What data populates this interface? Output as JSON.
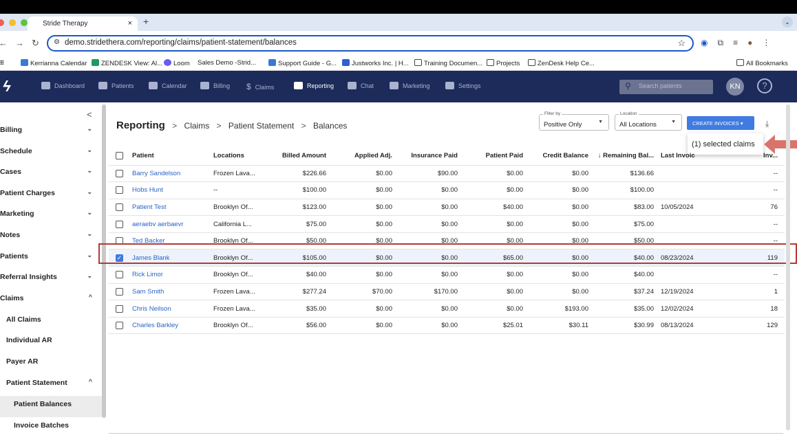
{
  "browser": {
    "tab_title": "Stride Therapy",
    "tab_close": "×",
    "new_tab": "+",
    "url": "demo.stridethera.com/reporting/claims/patient-statement/balances",
    "bookmarks": [
      "Kerrianna Calendar",
      "ZENDESK View: Al...",
      "Loom",
      "Sales Demo -Strid...",
      "Support Guide - G...",
      "Justworks Inc. | H...",
      "Training Documen...",
      "Projects",
      "ZenDesk Help Ce..."
    ],
    "all_bookmarks": "All Bookmarks"
  },
  "appnav": {
    "items": [
      "Dashboard",
      "Patients",
      "Calendar",
      "Billing",
      "Claims",
      "Reporting",
      "Chat",
      "Marketing",
      "Settings"
    ],
    "active": "Reporting",
    "search_placeholder": "Search patients",
    "avatar_initials": "KN",
    "help": "?"
  },
  "sidebar": {
    "collapse": "<",
    "items": [
      {
        "label": "Billing",
        "caret": "⌄"
      },
      {
        "label": "Schedule",
        "caret": "⌄"
      },
      {
        "label": "Cases",
        "caret": "⌄"
      },
      {
        "label": "Patient Charges",
        "caret": "⌄"
      },
      {
        "label": "Marketing",
        "caret": "⌄"
      },
      {
        "label": "Notes",
        "caret": "⌄"
      },
      {
        "label": "Patients",
        "caret": "⌄"
      },
      {
        "label": "Referral Insights",
        "caret": "⌄"
      },
      {
        "label": "Claims",
        "caret": "^"
      },
      {
        "label": "All Claims",
        "caret": ""
      },
      {
        "label": "Individual AR",
        "caret": ""
      },
      {
        "label": "Payer AR",
        "caret": ""
      },
      {
        "label": "Patient Statement",
        "caret": "^"
      },
      {
        "label": "Patient Balances",
        "caret": ""
      },
      {
        "label": "Invoice Batches",
        "caret": ""
      }
    ]
  },
  "breadcrumb": {
    "root": "Reporting",
    "items": [
      "Claims",
      "Patient Statement",
      "Balances"
    ],
    "sep": ">"
  },
  "filters": {
    "filter_label": "Filter by",
    "filter_value": "Positive Only",
    "location_label": "Location",
    "location_value": "All Locations"
  },
  "create_invoices": "CREATE INVOICES",
  "popup_text": "(1) selected claims",
  "table": {
    "columns": [
      "Patient",
      "Locations",
      "Billed Amount",
      "Applied Adj.",
      "Insurance Paid",
      "Patient Paid",
      "Credit Balance",
      "↓ Remaining Bal...",
      "Last Invoic",
      "Inv..."
    ],
    "rows": [
      {
        "name": "Barry Sandelson",
        "loc": "Frozen Lava...",
        "billed": "$226.66",
        "adj": "$0.00",
        "ins": "$90.00",
        "pp": "$0.00",
        "credit": "$0.00",
        "rem": "$136.66",
        "last": "",
        "inv": "--",
        "checked": false
      },
      {
        "name": "Hobs Hunt",
        "loc": "--",
        "billed": "$100.00",
        "adj": "$0.00",
        "ins": "$0.00",
        "pp": "$0.00",
        "credit": "$0.00",
        "rem": "$100.00",
        "last": "",
        "inv": "--",
        "checked": false
      },
      {
        "name": "Patient Test",
        "loc": "Brooklyn Of...",
        "billed": "$123.00",
        "adj": "$0.00",
        "ins": "$0.00",
        "pp": "$40.00",
        "credit": "$0.00",
        "rem": "$83.00",
        "last": "10/05/2024",
        "inv": "76",
        "checked": false
      },
      {
        "name": "aeraebv aerbaevr",
        "loc": "California L...",
        "billed": "$75.00",
        "adj": "$0.00",
        "ins": "$0.00",
        "pp": "$0.00",
        "credit": "$0.00",
        "rem": "$75.00",
        "last": "",
        "inv": "--",
        "checked": false
      },
      {
        "name": "Ted Backer",
        "loc": "Brooklyn Of...",
        "billed": "$50.00",
        "adj": "$0.00",
        "ins": "$0.00",
        "pp": "$0.00",
        "credit": "$0.00",
        "rem": "$50.00",
        "last": "",
        "inv": "--",
        "checked": false
      },
      {
        "name": "James Blank",
        "loc": "Brooklyn Of...",
        "billed": "$105.00",
        "adj": "$0.00",
        "ins": "$0.00",
        "pp": "$65.00",
        "credit": "$0.00",
        "rem": "$40.00",
        "last": "08/23/2024",
        "inv": "119",
        "checked": true
      },
      {
        "name": "Rick Limor",
        "loc": "Brooklyn Of...",
        "billed": "$40.00",
        "adj": "$0.00",
        "ins": "$0.00",
        "pp": "$0.00",
        "credit": "$0.00",
        "rem": "$40.00",
        "last": "",
        "inv": "--",
        "checked": false
      },
      {
        "name": "Sam Smith",
        "loc": "Frozen Lava...",
        "billed": "$277.24",
        "adj": "$70.00",
        "ins": "$170.00",
        "pp": "$0.00",
        "credit": "$0.00",
        "rem": "$37.24",
        "last": "12/19/2024",
        "inv": "1",
        "checked": false
      },
      {
        "name": "Chris Neilson",
        "loc": "Frozen Lava...",
        "billed": "$35.00",
        "adj": "$0.00",
        "ins": "$0.00",
        "pp": "$0.00",
        "credit": "$193.00",
        "rem": "$35.00",
        "last": "12/02/2024",
        "inv": "18",
        "checked": false
      },
      {
        "name": "Charles Barkley",
        "loc": "Brooklyn Of...",
        "billed": "$56.00",
        "adj": "$0.00",
        "ins": "$0.00",
        "pp": "$25.01",
        "credit": "$30.11",
        "rem": "$30.99",
        "last": "08/13/2024",
        "inv": "129",
        "checked": false
      }
    ]
  },
  "colors": {
    "nav_bg": "#1c2b5a",
    "accent": "#3f7be0",
    "highlight": "#b23a34",
    "arrow": "#d9746c"
  }
}
